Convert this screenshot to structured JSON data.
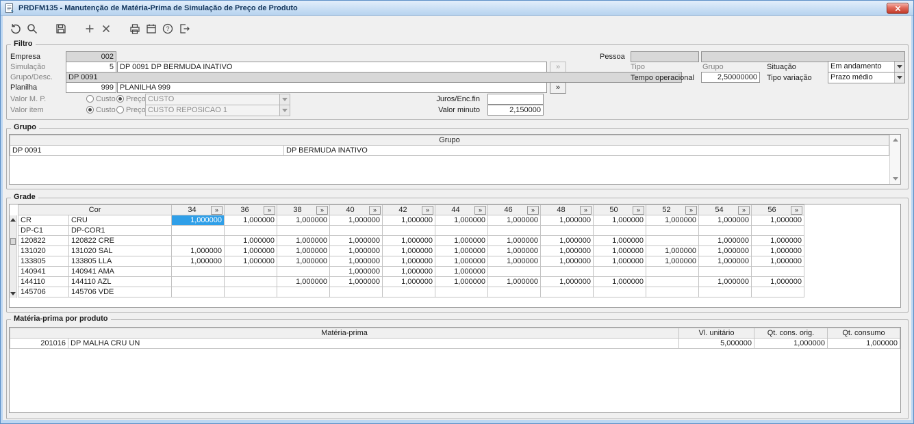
{
  "window": {
    "title": "PRDFM135 - Manutenção de Matéria-Prima de Simulação de Preço de Produto"
  },
  "toolbar": {
    "icons": [
      "refresh-icon",
      "search-icon",
      "save-icon",
      "add-icon",
      "delete-icon",
      "print-icon",
      "calendar-icon",
      "help-icon",
      "exit-icon"
    ]
  },
  "filtro": {
    "legend": "Filtro",
    "empresa": {
      "label": "Empresa",
      "value": "002"
    },
    "simulacao": {
      "label": "Simulação",
      "value": "5",
      "desc": "DP 0091 DP BERMUDA INATIVO"
    },
    "grupo_desc": {
      "label": "Grupo/Desc.",
      "value": "DP 0091"
    },
    "planilha": {
      "label": "Planilha",
      "value": "999",
      "desc": "PLANILHA 999"
    },
    "lookup_label": "»",
    "valor_mp": {
      "label": "Valor M. P.",
      "radio_custo": "Custo",
      "radio_preco": "Preço",
      "selected": "Preço",
      "combo": "CUSTO"
    },
    "valor_item": {
      "label": "Valor item",
      "radio_custo": "Custo",
      "radio_preco": "Preço",
      "selected": "Custo",
      "combo": "CUSTO REPOSICAO 1"
    },
    "juros": {
      "label": "Juros/Enc.fin",
      "value": ""
    },
    "valor_minuto": {
      "label": "Valor minuto",
      "value": "2,150000"
    },
    "pessoa": {
      "label": "Pessoa",
      "value1": "",
      "value2": ""
    },
    "tipo_label": "Tipo",
    "grupo_label": "Grupo",
    "situacao": {
      "label": "Situação",
      "value": "Em andamento"
    },
    "tempo_operacional": {
      "label": "Tempo operacional",
      "value": "2,50000000"
    },
    "tipo_variacao": {
      "label": "Tipo variação",
      "value": "Prazo médio"
    }
  },
  "grupo": {
    "legend": "Grupo",
    "header": "Grupo",
    "rows": [
      {
        "code": "DP 0091",
        "desc": "DP BERMUDA INATIVO"
      }
    ]
  },
  "grade": {
    "legend": "Grade",
    "cor_header": "Cor",
    "expand_button": "»",
    "sizes": [
      "34",
      "36",
      "38",
      "40",
      "42",
      "44",
      "46",
      "48",
      "50",
      "52",
      "54",
      "56"
    ],
    "selected": {
      "row": 0,
      "col": 0
    },
    "rows": [
      {
        "code": "CR",
        "name": "CRU",
        "values": [
          "1,000000",
          "1,000000",
          "1,000000",
          "1,000000",
          "1,000000",
          "1,000000",
          "1,000000",
          "1,000000",
          "1,000000",
          "1,000000",
          "1,000000",
          "1,000000"
        ]
      },
      {
        "code": "DP-C1",
        "name": "DP-COR1",
        "values": [
          "",
          "",
          "",
          "",
          "",
          "",
          "",
          "",
          "",
          "",
          "",
          ""
        ]
      },
      {
        "code": "120822",
        "name": "120822 CRE",
        "values": [
          "",
          "1,000000",
          "1,000000",
          "1,000000",
          "1,000000",
          "1,000000",
          "1,000000",
          "1,000000",
          "1,000000",
          "",
          "1,000000",
          "1,000000"
        ]
      },
      {
        "code": "131020",
        "name": "131020 SAL",
        "values": [
          "1,000000",
          "1,000000",
          "1,000000",
          "1,000000",
          "1,000000",
          "1,000000",
          "1,000000",
          "1,000000",
          "1,000000",
          "1,000000",
          "1,000000",
          "1,000000"
        ]
      },
      {
        "code": "133805",
        "name": "133805 LLA",
        "values": [
          "1,000000",
          "1,000000",
          "1,000000",
          "1,000000",
          "1,000000",
          "1,000000",
          "1,000000",
          "1,000000",
          "1,000000",
          "1,000000",
          "1,000000",
          "1,000000"
        ]
      },
      {
        "code": "140941",
        "name": "140941 AMA",
        "values": [
          "",
          "",
          "",
          "1,000000",
          "1,000000",
          "1,000000",
          "",
          "",
          "",
          "",
          "",
          ""
        ]
      },
      {
        "code": "144110",
        "name": "144110 AZL",
        "values": [
          "",
          "",
          "1,000000",
          "1,000000",
          "1,000000",
          "1,000000",
          "1,000000",
          "1,000000",
          "1,000000",
          "",
          "1,000000",
          "1,000000"
        ]
      },
      {
        "code": "145706",
        "name": "145706 VDE",
        "values": [
          "",
          "",
          "",
          "",
          "",
          "",
          "",
          "",
          "",
          "",
          "",
          ""
        ]
      }
    ]
  },
  "materia": {
    "legend": "Matéria-prima por produto",
    "headers": {
      "materia": "Matéria-prima",
      "vl_unitario": "Vl. unitário",
      "qt_cons_orig": "Qt. cons. orig.",
      "qt_consumo": "Qt. consumo"
    },
    "rows": [
      {
        "code": "201016",
        "name": "DP MALHA CRU UN",
        "vl_unitario": "5,000000",
        "qt_cons_orig": "1,000000",
        "qt_consumo": "1,000000"
      }
    ]
  }
}
